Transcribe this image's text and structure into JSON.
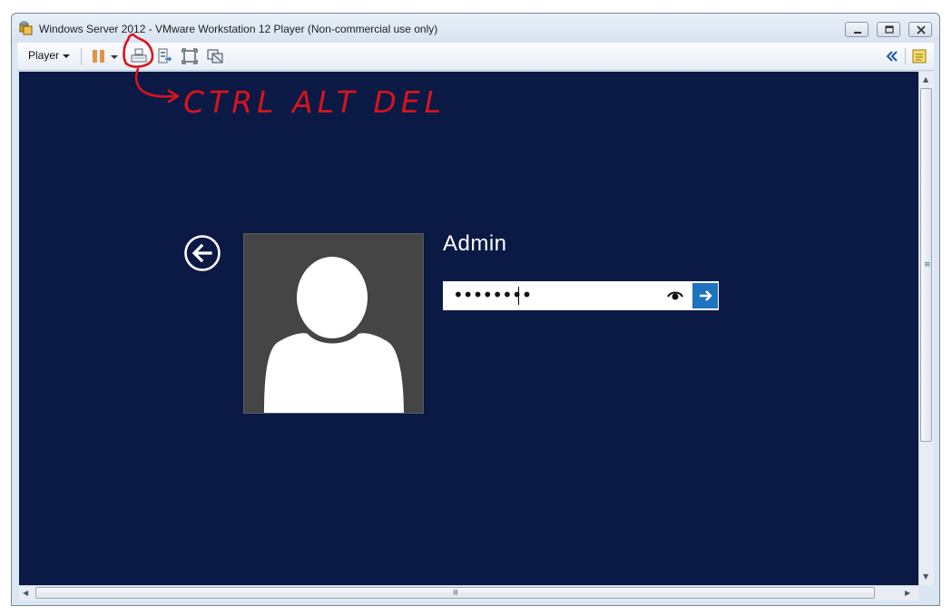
{
  "window": {
    "title": "Windows Server 2012 - VMware Workstation 12 Player (Non-commercial use only)",
    "icon": "vmware-player-icon"
  },
  "toolbar": {
    "player_label": "Player",
    "buttons": [
      "pause-icon",
      "dropdown-caret-icon",
      "ctrl-alt-del-icon",
      "removable-devices-icon",
      "full-screen-icon",
      "unity-icon",
      "collapse-icon",
      "notes-icon"
    ]
  },
  "login": {
    "user_name": "Admin",
    "password_mask": "••••••••",
    "accent_color": "#1e73be",
    "background_color": "#0b1a45"
  },
  "annotation": {
    "text": "CTRL ALT DEL",
    "color": "#d8141c"
  }
}
